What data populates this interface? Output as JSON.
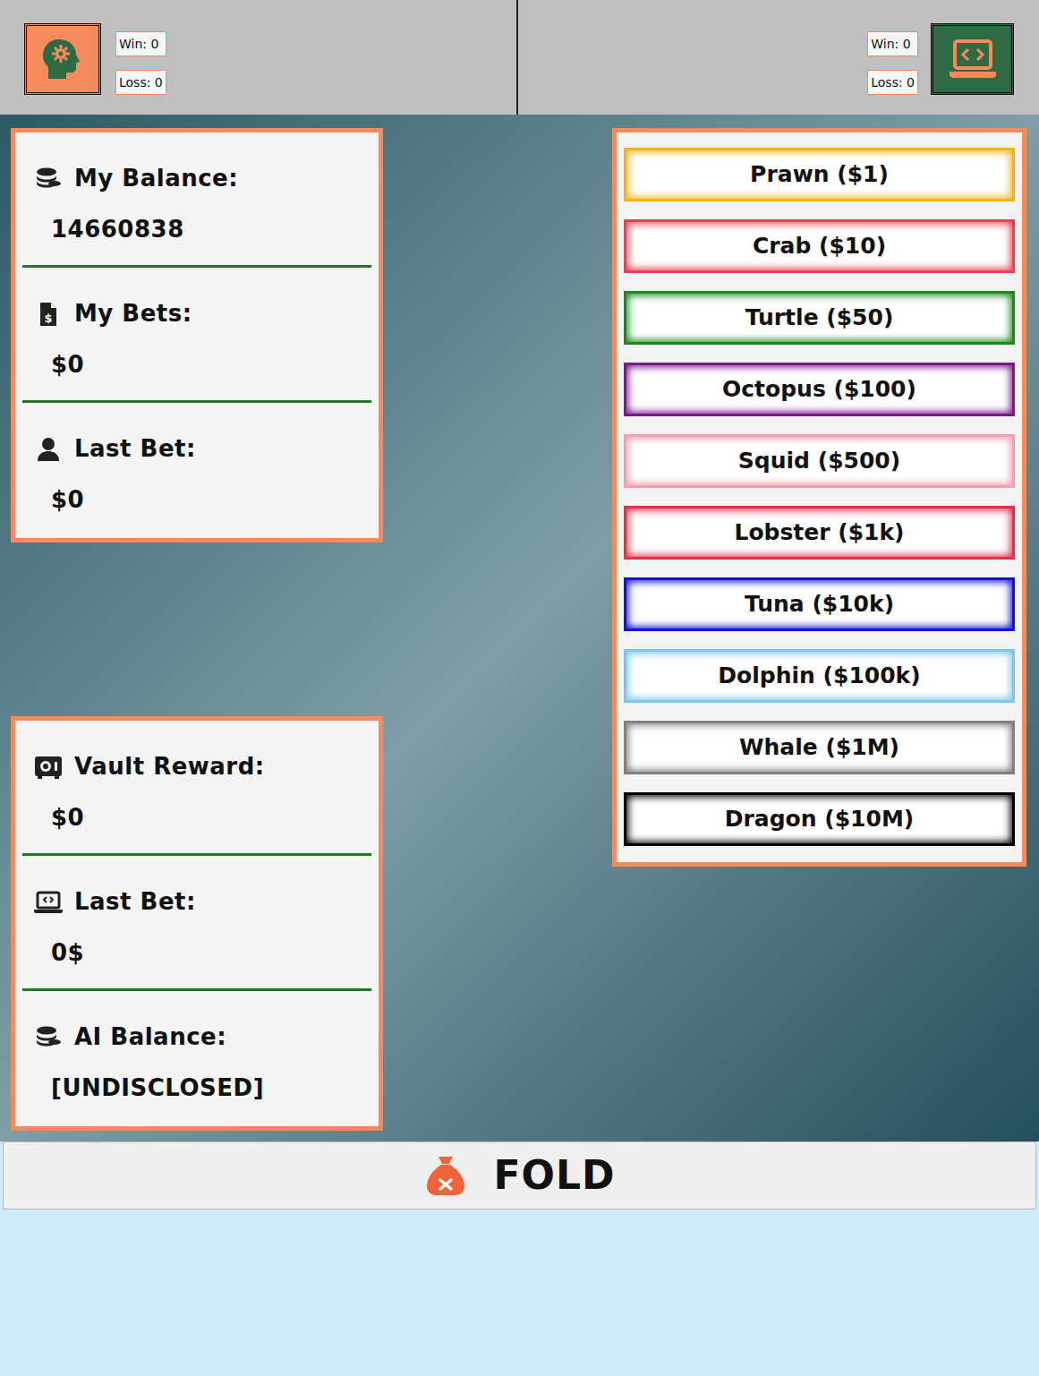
{
  "player": {
    "win": "Win: 0",
    "loss": "Loss: 0"
  },
  "ai": {
    "win": "Win: 0",
    "loss": "Loss: 0"
  },
  "my_panel": [
    {
      "label": "My Balance:",
      "value": "14660838"
    },
    {
      "label": "My Bets:",
      "value": "$0"
    },
    {
      "label": "Last Bet:",
      "value": "$0"
    }
  ],
  "ai_panel": [
    {
      "label": "Vault Reward:",
      "value": "$0"
    },
    {
      "label": "Last Bet:",
      "value": "0$"
    },
    {
      "label": "AI Balance:",
      "value": "[UNDISCLOSED]"
    }
  ],
  "bets": [
    {
      "label": "Prawn ($1)",
      "color": "#f5b21b"
    },
    {
      "label": "Crab ($10)",
      "color": "#f04050"
    },
    {
      "label": "Turtle ($50)",
      "color": "#1a8a1a"
    },
    {
      "label": "Octopus ($100)",
      "color": "#7a1a8a"
    },
    {
      "label": "Squid ($500)",
      "color": "#f2a0b0"
    },
    {
      "label": "Lobster ($1k)",
      "color": "#e0304a"
    },
    {
      "label": "Tuna ($10k)",
      "color": "#1010e0"
    },
    {
      "label": "Dolphin ($100k)",
      "color": "#7ac8f0"
    },
    {
      "label": "Whale ($1M)",
      "color": "#808080"
    },
    {
      "label": "Dragon ($10M)",
      "color": "#000000"
    }
  ],
  "fold": {
    "label": "FOLD"
  }
}
